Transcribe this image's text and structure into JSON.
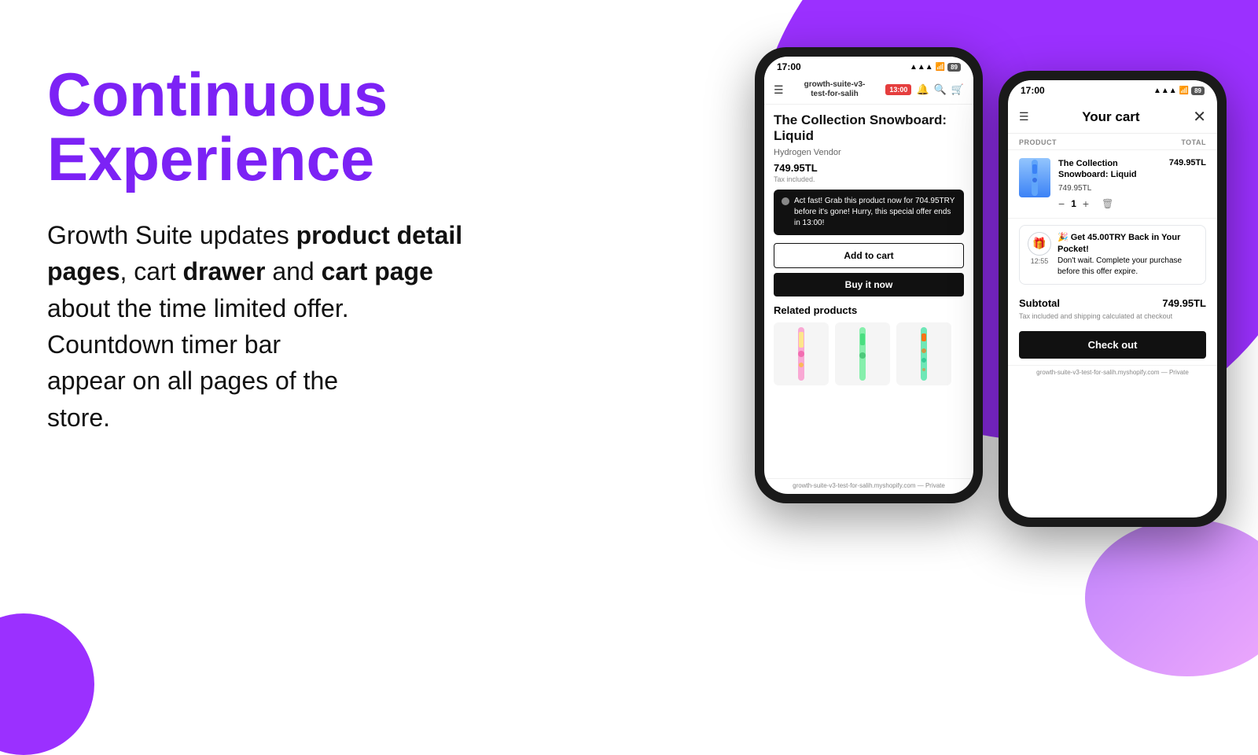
{
  "page": {
    "background": {
      "circle_large_color": "#9b30ff",
      "circle_small_color": "#9b30ff",
      "gradient_bottom": "#c084fc"
    }
  },
  "hero": {
    "title_line1": "Continuous",
    "title_line2": "Experience",
    "description_part1": "Growth Suite updates",
    "description_bold1": "product detail pages",
    "description_part2": ", cart",
    "description_bold2": "drawer",
    "description_part3": " and ",
    "description_bold3": "cart page",
    "description_part4": "about the time limited offer.",
    "description_part5": "Countdown timer bar",
    "description_part6": "appear on all pages of the",
    "description_part7": "store."
  },
  "phone1": {
    "status_time": "17:00",
    "status_icons": "▲ ▲ ▲",
    "nav_store_name": "growth-suite-v3-\ntest-for-salih",
    "timer_label": "13:00",
    "product_title": "The Collection Snowboard: Liquid",
    "vendor": "Hydrogen Vendor",
    "price": "749.95TL",
    "tax": "Tax included.",
    "urgency_text": "Act fast! Grab this product now for 704.95TRY before it's gone! Hurry, this special offer ends in 13:00!",
    "add_to_cart": "Add to cart",
    "buy_now": "Buy it now",
    "related_title": "Related products",
    "url": "growth-suite-v3-test-for-salih.myshopify.com — Private"
  },
  "phone2": {
    "status_time": "17:00",
    "cart_title": "Your cart",
    "col_product": "PRODUCT",
    "col_total": "TOTAL",
    "item_name": "The Collection Snowboard: Liquid",
    "item_price": "749.95TL",
    "item_total": "749.95TL",
    "item_qty": "1",
    "cashback_title": "🎉 Get 45.00TRY Back in Your Pocket!",
    "cashback_body": "Don't wait. Complete your purchase before this offer expire.",
    "cashback_time": "12:55",
    "subtotal_label": "Subtotal",
    "subtotal_value": "749.95TL",
    "tax_shipping_note": "Tax included and shipping calculated at checkout",
    "checkout_label": "Check out",
    "url": "growth-suite-v3-test-for-salih.myshopify.com — Private"
  }
}
